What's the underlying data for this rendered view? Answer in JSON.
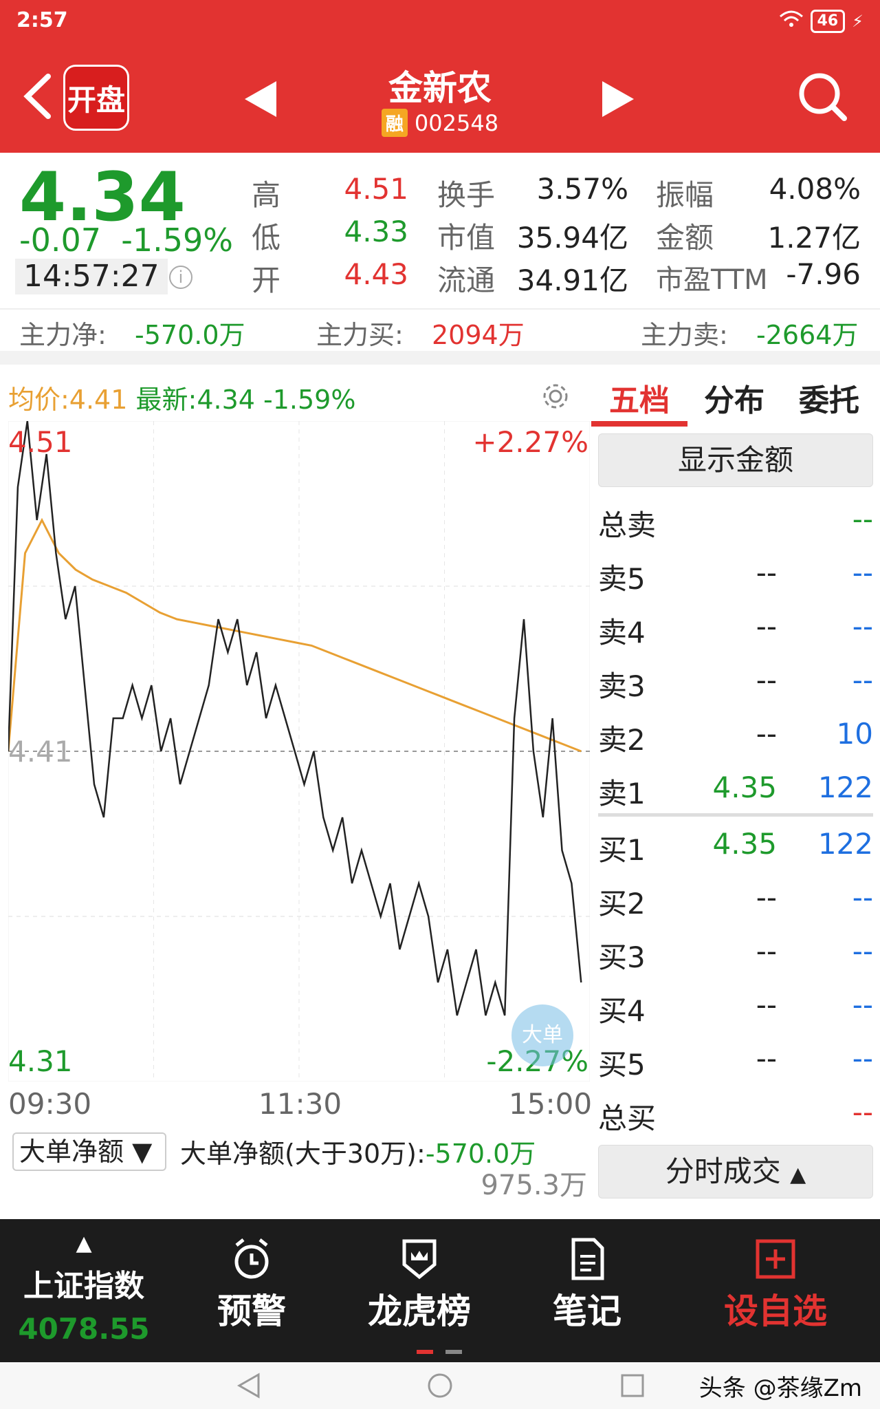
{
  "status_bar": {
    "time": "2:57",
    "battery": "46"
  },
  "header": {
    "logo_text": "开盘",
    "stock_name": "金新农",
    "stock_badge": "融",
    "stock_code": "002548"
  },
  "quote": {
    "price": "4.34",
    "change": "-0.07",
    "change_pct": "-1.59%",
    "time": "14:57:27",
    "stats": [
      {
        "label": "高",
        "value": "4.51",
        "color": "red"
      },
      {
        "label": "低",
        "value": "4.33",
        "color": "green"
      },
      {
        "label": "开",
        "value": "4.43",
        "color": "red"
      }
    ],
    "stats2": [
      {
        "label": "换手",
        "value": "3.57%"
      },
      {
        "label": "市值",
        "value": "35.94亿"
      },
      {
        "label": "流通",
        "value": "34.91亿"
      }
    ],
    "stats3": [
      {
        "label": "振幅",
        "value": "4.08%"
      },
      {
        "label": "金额",
        "value": "1.27亿"
      },
      {
        "label": "市盈TTM",
        "value": "-7.96"
      }
    ]
  },
  "flow": {
    "net_label": "主力净:",
    "net_value": "-570.0万",
    "buy_label": "主力买:",
    "buy_value": "2094万",
    "sell_label": "主力卖:",
    "sell_value": "-2664万"
  },
  "chart_caption": {
    "avg": "均价:4.41",
    "latest": "最新:4.34",
    "pct": "-1.59%"
  },
  "chart_data": {
    "type": "line",
    "x_ticks": [
      "09:30",
      "11:30",
      "15:00"
    ],
    "y_left_labels": {
      "top": "4.51",
      "mid": "4.41",
      "bottom": "4.31"
    },
    "y_right_labels": {
      "top": "+2.27%",
      "bottom": "-2.27%"
    },
    "ylim": [
      4.31,
      4.51
    ],
    "series": [
      {
        "values": [
          4.41,
          4.49,
          4.51,
          4.48,
          4.5,
          4.47,
          4.45,
          4.46,
          4.43,
          4.4,
          4.39,
          4.42,
          4.42,
          4.43,
          4.42,
          4.43,
          4.41,
          4.42,
          4.4,
          4.41,
          4.42,
          4.43,
          4.45,
          4.44,
          4.45,
          4.43,
          4.44,
          4.42,
          4.43,
          4.42,
          4.41,
          4.4,
          4.41,
          4.39,
          4.38,
          4.39,
          4.37,
          4.38,
          4.37,
          4.36,
          4.37,
          4.35,
          4.36,
          4.37,
          4.36,
          4.34,
          4.35,
          4.33,
          4.34,
          4.35,
          4.33,
          4.34,
          4.33,
          4.42,
          4.45,
          4.41,
          4.39,
          4.42,
          4.38,
          4.37,
          4.34
        ]
      },
      {
        "values": [
          4.41,
          4.47,
          4.48,
          4.47,
          4.465,
          4.462,
          4.46,
          4.458,
          4.455,
          4.452,
          4.45,
          4.449,
          4.448,
          4.447,
          4.446,
          4.445,
          4.444,
          4.443,
          4.442,
          4.44,
          4.438,
          4.436,
          4.434,
          4.432,
          4.43,
          4.428,
          4.426,
          4.424,
          4.422,
          4.42,
          4.418,
          4.416,
          4.414,
          4.412,
          4.41
        ]
      }
    ],
    "sub_chart_label": "大单净额",
    "sub_chart_caption": "大单净额(大于30万):",
    "sub_chart_value": "-570.0万",
    "sub_chart_scale": "975.3万",
    "badge": "大单"
  },
  "panel": {
    "tabs": [
      "五档",
      "分布",
      "委托"
    ],
    "toggle_button": "显示金额",
    "total_sell": {
      "label": "总卖",
      "value": "--"
    },
    "sells": [
      {
        "label": "卖5",
        "price": "--",
        "vol": "--"
      },
      {
        "label": "卖4",
        "price": "--",
        "vol": "--"
      },
      {
        "label": "卖3",
        "price": "--",
        "vol": "--"
      },
      {
        "label": "卖2",
        "price": "--",
        "vol": "10"
      },
      {
        "label": "卖1",
        "price": "4.35",
        "vol": "122"
      }
    ],
    "buys": [
      {
        "label": "买1",
        "price": "4.35",
        "vol": "122"
      },
      {
        "label": "买2",
        "price": "--",
        "vol": "--"
      },
      {
        "label": "买3",
        "price": "--",
        "vol": "--"
      },
      {
        "label": "买4",
        "price": "--",
        "vol": "--"
      },
      {
        "label": "买5",
        "price": "--",
        "vol": "--"
      }
    ],
    "total_buy": {
      "label": "总买",
      "value": "--"
    },
    "trades_button": "分时成交"
  },
  "bottom_nav": {
    "index_name": "上证指数",
    "index_value": "4078.55",
    "items": [
      "预警",
      "龙虎榜",
      "笔记",
      "设自选"
    ]
  },
  "watermark": "头条 @茶缘Zm",
  "colors": {
    "red": "#e23331",
    "green": "#1e9a2c",
    "blue": "#1e6fe0",
    "avg_line": "#e8a033"
  }
}
